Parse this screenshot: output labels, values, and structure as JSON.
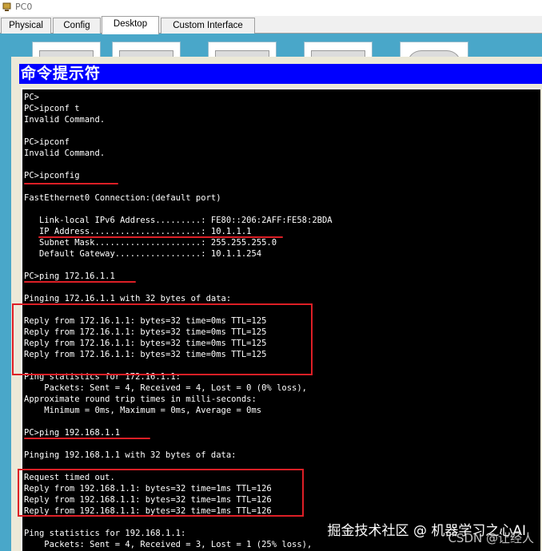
{
  "window": {
    "title": "PC0"
  },
  "tabs": [
    {
      "label": "Physical",
      "active": false
    },
    {
      "label": "Config",
      "active": false
    },
    {
      "label": "Desktop",
      "active": true
    },
    {
      "label": "Custom Interface",
      "active": false
    }
  ],
  "cmd_window": {
    "title": "命令提示符"
  },
  "terminal": {
    "lines": [
      "PC>",
      "PC>ipconf t",
      "Invalid Command.",
      "",
      "PC>ipconf",
      "Invalid Command.",
      "",
      "PC>ipconfig",
      "",
      "FastEthernet0 Connection:(default port)",
      "",
      "   Link-local IPv6 Address.........: FE80::206:2AFF:FE58:2BDA",
      "   IP Address......................: 10.1.1.1",
      "   Subnet Mask.....................: 255.255.255.0",
      "   Default Gateway.................: 10.1.1.254",
      "",
      "PC>ping 172.16.1.1",
      "",
      "Pinging 172.16.1.1 with 32 bytes of data:",
      "",
      "Reply from 172.16.1.1: bytes=32 time=0ms TTL=125",
      "Reply from 172.16.1.1: bytes=32 time=0ms TTL=125",
      "Reply from 172.16.1.1: bytes=32 time=0ms TTL=125",
      "Reply from 172.16.1.1: bytes=32 time=0ms TTL=125",
      "",
      "Ping statistics for 172.16.1.1:",
      "    Packets: Sent = 4, Received = 4, Lost = 0 (0% loss),",
      "Approximate round trip times in milli-seconds:",
      "    Minimum = 0ms, Maximum = 0ms, Average = 0ms",
      "",
      "PC>ping 192.168.1.1",
      "",
      "Pinging 192.168.1.1 with 32 bytes of data:",
      "",
      "Request timed out.",
      "Reply from 192.168.1.1: bytes=32 time=1ms TTL=126",
      "Reply from 192.168.1.1: bytes=32 time=1ms TTL=126",
      "Reply from 192.168.1.1: bytes=32 time=1ms TTL=126",
      "",
      "Ping statistics for 192.168.1.1:",
      "    Packets: Sent = 4, Received = 3, Lost = 1 (25% loss),"
    ]
  },
  "colors": {
    "desktop_bg": "#49a7c9",
    "cmd_titlebar": "#0000ff",
    "terminal_bg": "#000000",
    "terminal_text": "#ffffff",
    "annotation": "#dd1f26"
  },
  "watermark": {
    "line1": "掘金技术社区 @ 机器学习之心AI",
    "line2": "CSDN @让经人"
  }
}
